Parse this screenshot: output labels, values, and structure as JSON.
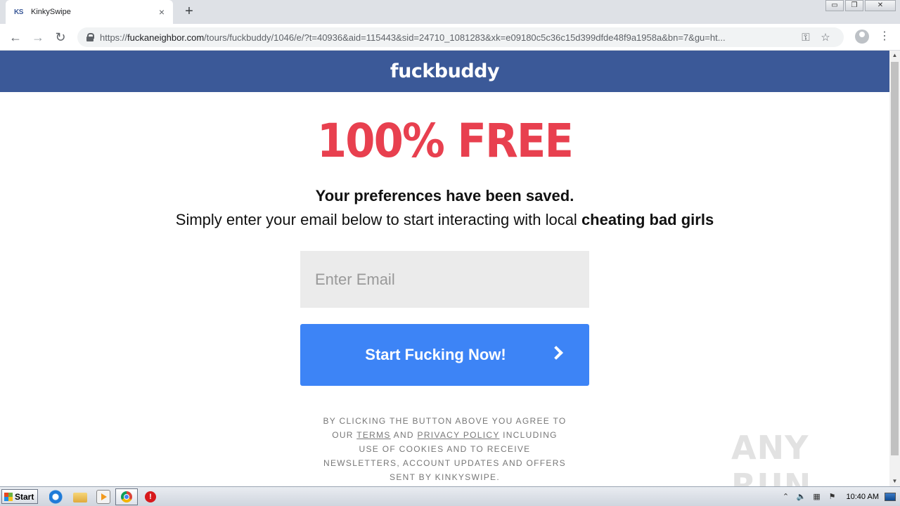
{
  "browser": {
    "tab": {
      "favicon_text": "KS",
      "title": "KinkySwipe",
      "close_glyph": "×"
    },
    "new_tab_glyph": "+",
    "window_controls": {
      "minimize": "▭",
      "restore": "❐",
      "close": "✕"
    },
    "nav": {
      "back": "←",
      "forward": "→",
      "reload": "↻"
    },
    "url": {
      "scheme": "https://",
      "host": "fuckaneighbor.com",
      "path": "/tours/fuckbuddy/1046/e/?t=40936&aid=115443&sid=24710_1081283&xk=e09180c5c36c15d399dfde48f9a1958a&bn=7&gu=ht..."
    },
    "omnibox_icons": {
      "key": "⚿",
      "star": "☆"
    },
    "menu_glyph": "⋮"
  },
  "page": {
    "logo": "fuckbuddy",
    "headline": "100% FREE",
    "saved_message": "Your preferences have been saved.",
    "subline_prefix": "Simply enter your email below to start interacting with local ",
    "subline_bold": "cheating bad girls",
    "email_placeholder": "Enter Email",
    "email_value": "",
    "cta_label": "Start Fucking Now!",
    "legal": {
      "line1": "By clicking the button above you agree to our ",
      "terms": "Terms",
      "and": " and ",
      "privacy": "Privacy Policy",
      "line2": " including use of cookies and to receive newsletters, account updates and offers sent by KinkySwipe."
    }
  },
  "watermark": "ANY RUN",
  "scrollbar": {
    "up": "▲",
    "down": "▼"
  },
  "taskbar": {
    "start_label": "Start",
    "stop_glyph": "!",
    "tray": {
      "expand": "⌃",
      "volume": "🔈",
      "network": "▦",
      "flag": "⚑"
    },
    "clock": "10:40 AM"
  },
  "colors": {
    "header_bg": "#3b5998",
    "headline": "#e8404f",
    "cta_bg": "#3d84f6"
  }
}
